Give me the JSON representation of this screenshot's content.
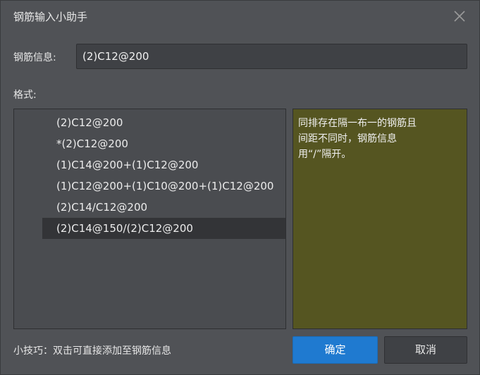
{
  "dialog": {
    "title": "钢筋输入小助手",
    "close_icon": "close-icon"
  },
  "info": {
    "label": "钢筋信息:",
    "value": "(2)C12@200"
  },
  "format": {
    "label": "格式:",
    "items": [
      "(2)C12@200",
      "*(2)C12@200",
      "(1)C14@200+(1)C12@200",
      "(1)C12@200+(1)C10@200+(1)C12@200",
      "(2)C14/C12@200",
      "(2)C14@150/(2)C12@200"
    ],
    "selected_index": 5
  },
  "description": {
    "lines": [
      "同排存在隔一布一的钢筋且",
      "间距不同时，钢筋信息",
      "用“/”隔开。"
    ],
    "background": "#555521"
  },
  "tip": "小技巧：双击可直接添加至钢筋信息",
  "buttons": {
    "ok_label": "确定",
    "cancel_label": "取消",
    "ok_color": "#1f7ad0"
  }
}
